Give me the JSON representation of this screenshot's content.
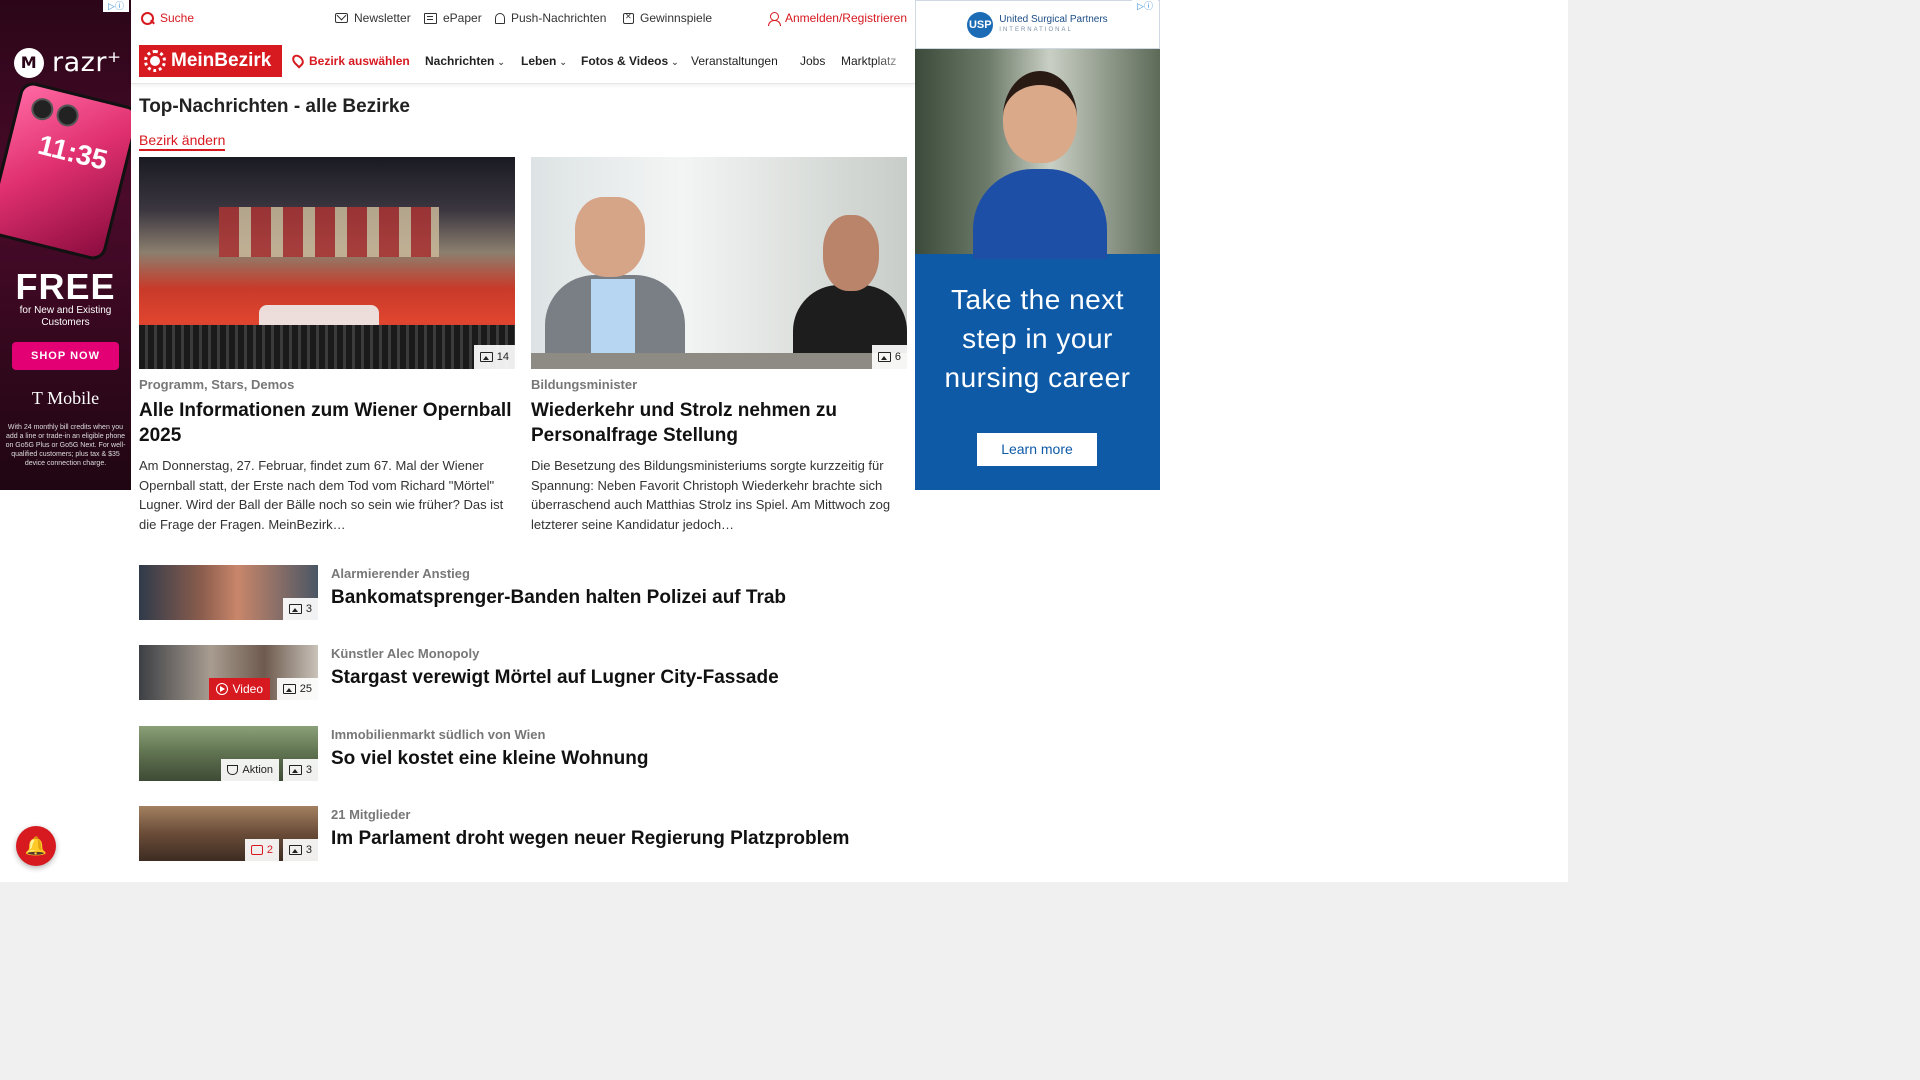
{
  "left_ad": {
    "adchoice": "▷ⓘ",
    "brand": "razr⁺",
    "brand_logo": "M",
    "phone_time": "11:35",
    "free": "FREE",
    "free_sub": "for New and Existing Customers",
    "cta": "SHOP NOW",
    "advertiser": "T Mobile",
    "fine_print": "With 24 monthly bill credits when you add a line or trade-in an eligible phone on Go5G Plus or Go5G Next. For well-qualified customers; plus tax & $35 device connection charge.",
    "colors": {
      "background": "#2b0618",
      "accent": "#e20074"
    }
  },
  "right_ad": {
    "adchoice": "▷ⓘ",
    "logo_mark": "USP",
    "logo_name": "United Surgical Partners",
    "logo_sub": "INTERNATIONAL",
    "headline": "Take the next step in your nursing career",
    "cta": "Learn more",
    "colors": {
      "background": "#0e5aa7"
    }
  },
  "utility": {
    "search": "Suche",
    "newsletter": "Newsletter",
    "epaper": "ePaper",
    "push": "Push-Nachrichten",
    "games": "Gewinnspiele",
    "login": "Anmelden/Registrieren"
  },
  "nav": {
    "logo": "MeinBezirk",
    "select_district": "Bezirk auswählen",
    "items": [
      {
        "label": "Nachrichten",
        "dropdown": true
      },
      {
        "label": "Leben",
        "dropdown": true
      },
      {
        "label": "Fotos & Videos",
        "dropdown": true
      },
      {
        "label": "Veranstaltungen",
        "dropdown": false
      },
      {
        "label": "Jobs",
        "dropdown": false
      },
      {
        "label": "Marktplatz",
        "dropdown": false
      }
    ],
    "chevron": "⌄"
  },
  "main": {
    "section_title": "Top-Nachrichten - alle Bezirke",
    "change_district": "Bezirk ändern",
    "heroes": [
      {
        "photo_count": "14",
        "kicker": "Programm, Stars, Demos",
        "title": "Alle Informationen zum Wiener Opernball 2025",
        "teaser": "Am Donnerstag, 27. Februar, findet zum 67. Mal der Wiener Opernball statt, der Erste nach dem Tod vom Richard \"Mörtel\" Lugner. Wird der Ball der Bälle noch so sein wie früher? Das ist die Frage der Fragen. MeinBezirk…"
      },
      {
        "photo_count": "6",
        "kicker": "Bildungsminister",
        "title": "Wiederkehr und Strolz nehmen zu Personalfrage Stellung",
        "teaser": "Die Besetzung des Bildungsministeriums sorgte kurzzeitig für Spannung: Neben Favorit Christoph Wiederkehr brachte sich überraschend auch Matthias Strolz ins Spiel. Am Mittwoch zog letzterer seine Kandidatur jedoch…"
      }
    ],
    "list": [
      {
        "kicker": "Alarmierender Anstieg",
        "title": "Bankomatsprenger-Banden halten Polizei auf Trab",
        "photo_count": "3"
      },
      {
        "kicker": "Künstler Alec Monopoly",
        "title": "Stargast verewigt Mörtel auf Lugner City-Fassade",
        "photo_count": "25",
        "video_label": "Video"
      },
      {
        "kicker": "Immobilienmarkt südlich von Wien",
        "title": "So viel kostet eine kleine Wohnung",
        "photo_count": "3",
        "action_label": "Aktion"
      },
      {
        "kicker": "21 Mitglieder",
        "title": "Im Parlament droht wegen neuer Regierung Platzproblem",
        "photo_count": "3",
        "comment_count": "2"
      }
    ]
  },
  "fab_icon": "bell-icon",
  "colors": {
    "brand_red": "#d71920"
  }
}
